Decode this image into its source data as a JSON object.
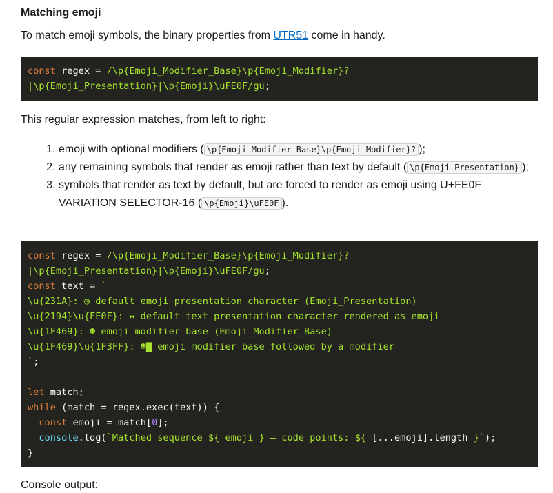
{
  "heading": "Matching emoji",
  "intro": {
    "before": "To match emoji symbols, the binary properties from ",
    "link": "UTR51",
    "after": " come in handy."
  },
  "code1": {
    "l1_kw": "const",
    "l1_a": " regex = ",
    "l1_rx": "/\\p{Emoji_Modifier_Base}\\p{Emoji_Modifier}?",
    "l2_rx": "|\\p{Emoji_Presentation}|\\p{Emoji}\\uFE0F/gu",
    "l2_end": ";"
  },
  "explain": "This regular expression matches, from left to right:",
  "list": [
    {
      "text": "emoji with optional modifiers (",
      "code": "\\p{Emoji_Modifier_Base}\\p{Emoji_Modifier}?",
      "end": ");"
    },
    {
      "text": "any remaining symbols that render as emoji rather than text by default (",
      "code": "\\p{Emoji_Presentation}",
      "end": ");"
    },
    {
      "text": "symbols that render as text by default, but are forced to render as emoji using U+FE0F VARIATION SELECTOR-16 (",
      "code": "\\p{Emoji}\\uFE0F",
      "end": ")."
    }
  ],
  "code2": {
    "kw_const": "const",
    "kw_let": "let",
    "kw_while": "while",
    "l1_a": " regex = ",
    "l1_rx": "/\\p{Emoji_Modifier_Base}\\p{Emoji_Modifier}?",
    "l2_rx": "|\\p{Emoji_Presentation}|\\p{Emoji}\\uFE0F/gu",
    "l2_end": ";",
    "l3_a": " text = ",
    "l3_str": "`",
    "s1": "\\u{231A}: ◷ default emoji presentation character (Emoji_Presentation)",
    "s2": "\\u{2194}\\u{FE0F}: ↔ default text presentation character rendered as emoji",
    "s3": "\\u{1F469}: ☻ emoji modifier base (Emoji_Modifier_Base)",
    "s4": "\\u{1F469}\\u{1F3FF}: ☻▇ emoji modifier base followed by a modifier",
    "s5": "`",
    "s5_end": ";",
    "l9_a": " match;",
    "l10_a": " (match = regex.exec(text)) {",
    "l11_a": " emoji = match[",
    "l11_num": "0",
    "l11_b": "];",
    "l12_cls": "console",
    "l12_a": ".log(",
    "l12_str1": "`Matched sequence ${ emoji } — code points: ${ ",
    "l12_mid": "[...emoji].length",
    "l12_str2": " }`",
    "l12_end": ");",
    "l13": "}"
  },
  "console_label": "Console output:"
}
